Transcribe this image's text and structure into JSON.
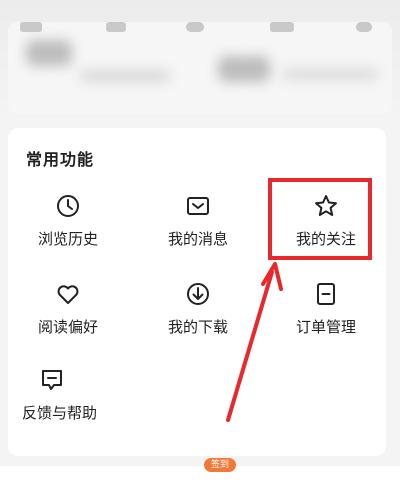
{
  "section": {
    "title": "常用功能"
  },
  "items": [
    {
      "label": "浏览历史",
      "icon": "clock-icon"
    },
    {
      "label": "我的消息",
      "icon": "message-box-icon"
    },
    {
      "label": "我的关注",
      "icon": "star-icon"
    },
    {
      "label": "阅读偏好",
      "icon": "heart-icon"
    },
    {
      "label": "我的下载",
      "icon": "download-icon"
    },
    {
      "label": "订单管理",
      "icon": "order-doc-icon"
    },
    {
      "label": "反馈与帮助",
      "icon": "feedback-icon"
    }
  ],
  "bottom_nav": {
    "badge": "签到"
  },
  "colors": {
    "highlight": "#e8282b",
    "badge": "#f07a3a"
  }
}
